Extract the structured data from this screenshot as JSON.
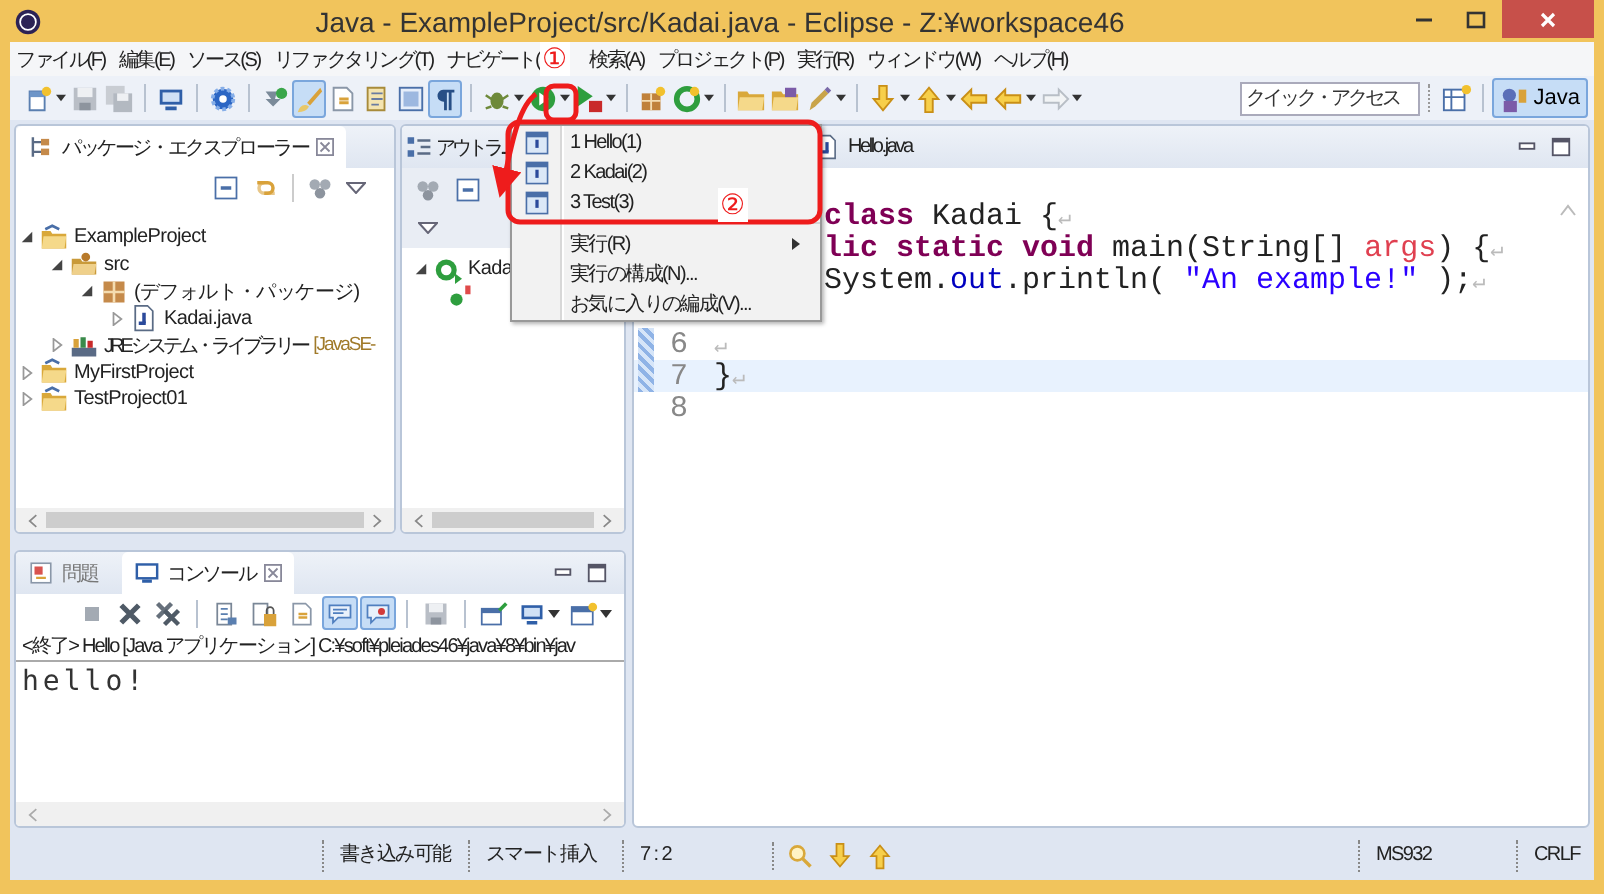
{
  "window": {
    "title": "Java - ExampleProject/src/Kadai.java - Eclipse - Z:¥workspace46"
  },
  "menu_bar": [
    "ファイル(F)",
    "編集(E)",
    "ソース(S)",
    "リファクタリング(T)",
    "ナビゲート(",
    "検索(A)",
    "プロジェクト(P)",
    "実行(R)",
    "ウィンドウ(W)",
    "ヘルプ(H)"
  ],
  "toolbar": [
    {
      "kind": "newdoc",
      "pressed": false,
      "dropdown": true
    },
    {
      "kind": "save",
      "pressed": false,
      "dropdown": false
    },
    {
      "kind": "saveall",
      "pressed": false,
      "dropdown": false
    },
    {
      "kind": "separator"
    },
    {
      "kind": "monitor",
      "pressed": false,
      "dropdown": false
    },
    {
      "kind": "separator"
    },
    {
      "kind": "gear",
      "pressed": false,
      "dropdown": false
    },
    {
      "kind": "separator"
    },
    {
      "kind": "pin",
      "pressed": false,
      "dropdown": false
    },
    {
      "kind": "brush",
      "pressed": true,
      "dropdown": false
    },
    {
      "kind": "docarrow",
      "pressed": false,
      "dropdown": false
    },
    {
      "kind": "docedit",
      "pressed": false,
      "dropdown": false
    },
    {
      "kind": "window",
      "pressed": false,
      "dropdown": false
    },
    {
      "kind": "pilcrow",
      "pressed": true,
      "dropdown": false
    },
    {
      "kind": "separator"
    },
    {
      "kind": "debug",
      "pressed": false,
      "dropdown": true
    },
    {
      "kind": "run",
      "pressed": false,
      "dropdown": true
    },
    {
      "kind": "runext",
      "pressed": false,
      "dropdown": true
    },
    {
      "kind": "separator"
    },
    {
      "kind": "classnew",
      "pressed": false,
      "dropdown": false
    },
    {
      "kind": "gcircle",
      "pressed": false,
      "dropdown": true
    },
    {
      "kind": "separator"
    },
    {
      "kind": "folder",
      "pressed": false,
      "dropdown": false
    },
    {
      "kind": "folderpkg",
      "pressed": false,
      "dropdown": false
    },
    {
      "kind": "marker",
      "pressed": false,
      "dropdown": true
    },
    {
      "kind": "separator"
    },
    {
      "kind": "down",
      "pressed": false,
      "dropdown": true
    },
    {
      "kind": "up",
      "pressed": false,
      "dropdown": true
    },
    {
      "kind": "back",
      "pressed": false,
      "dropdown": false
    },
    {
      "kind": "left",
      "pressed": false,
      "dropdown": true
    },
    {
      "kind": "right",
      "pressed": false,
      "dropdown": true
    }
  ],
  "quick_access": {
    "placeholder": "クイック・アクセス"
  },
  "perspectives": [
    {
      "label": "Java",
      "selected": true
    }
  ],
  "package_explorer": {
    "title": "パッケージ・エクスプローラー",
    "tree": [
      {
        "label": "ExampleProject",
        "kind": "project",
        "expanded": true,
        "children": [
          {
            "label": "src",
            "kind": "srcfolder",
            "expanded": true,
            "children": [
              {
                "label": "(デフォルト・パッケージ)",
                "kind": "package",
                "expanded": true,
                "children": [
                  {
                    "label": "Kadai.java",
                    "kind": "javafile",
                    "expanded": false
                  }
                ]
              }
            ]
          },
          {
            "label": "JRE システム・ライブラリー",
            "decoration": "[JavaSE-",
            "kind": "library",
            "expanded": false
          }
        ]
      },
      {
        "label": "MyFirstProject",
        "kind": "project",
        "expanded": false
      },
      {
        "label": "TestProject01",
        "kind": "project",
        "expanded": false
      }
    ]
  },
  "outline": {
    "title": "アウトラ...",
    "tree": [
      {
        "label": "Kada",
        "kind": "classnode",
        "expanded": true,
        "children": [
          {
            "kind": "method"
          }
        ]
      }
    ]
  },
  "run_menu": {
    "items": [
      {
        "kind": "launch",
        "label": "1 Hello(1)"
      },
      {
        "kind": "launch",
        "label": "2 Kadai(2)"
      },
      {
        "kind": "launch",
        "label": "3 Test(3)"
      },
      {
        "kind": "separator"
      },
      {
        "kind": "submenu",
        "label": "実行(R)"
      },
      {
        "kind": "command",
        "label": "実行の構成(N)..."
      },
      {
        "kind": "command",
        "label": "お気に入りの編成(V)..."
      }
    ]
  },
  "annotations": [
    {
      "kind": "step",
      "label": "①"
    },
    {
      "kind": "step",
      "label": "②"
    }
  ],
  "editor": {
    "tabs": [
      {
        "label": "Hello.java",
        "selected": false
      }
    ],
    "lines": [
      {
        "kind": "covered"
      },
      {
        "kind": "partial",
        "tokens": [
          {
            "t": "class",
            "kind": "keyword"
          },
          {
            "t": " Kadai {",
            "kind": "plain"
          },
          {
            "t": "↵",
            "kind": "mark"
          }
        ]
      },
      {
        "kind": "partial",
        "tokens": [
          {
            "t": "lic static void",
            "kind": "keyword"
          },
          {
            "t": " main(String[] ",
            "kind": "plain"
          },
          {
            "t": "args",
            "kind": "param"
          },
          {
            "t": ") {",
            "kind": "plain"
          },
          {
            "t": "↵",
            "kind": "mark"
          }
        ]
      },
      {
        "kind": "partial",
        "tokens": [
          {
            "t": "System.",
            "kind": "plain"
          },
          {
            "t": "out",
            "kind": "field"
          },
          {
            "t": ".println( ",
            "kind": "plain"
          },
          {
            "t": "\"An example!\"",
            "kind": "string"
          },
          {
            "t": " );",
            "kind": "plain"
          },
          {
            "t": "↵",
            "kind": "mark"
          }
        ]
      },
      {
        "kind": "covered"
      },
      {
        "kind": "code",
        "number": "6",
        "current": false,
        "tokens": [
          {
            "t": "↵",
            "kind": "mark"
          }
        ]
      },
      {
        "kind": "code",
        "number": "7",
        "current": true,
        "tokens": [
          {
            "t": "}",
            "kind": "plain"
          },
          {
            "t": "↵",
            "kind": "mark"
          }
        ]
      },
      {
        "kind": "code",
        "number": "8",
        "current": false
      }
    ]
  },
  "console": {
    "tabs": [
      {
        "label": "問題",
        "selected": false
      },
      {
        "label": "コンソール",
        "selected": true
      }
    ],
    "toolbar": [
      {
        "kind": "stop",
        "pressed": false,
        "dropdown": false
      },
      {
        "kind": "remove",
        "pressed": false,
        "dropdown": false
      },
      {
        "kind": "removeall",
        "pressed": false,
        "dropdown": false
      },
      {
        "kind": "separator"
      },
      {
        "kind": "sheet",
        "pressed": false,
        "dropdown": false
      },
      {
        "kind": "lockdoc",
        "pressed": false,
        "dropdown": false
      },
      {
        "kind": "docarrow",
        "pressed": false,
        "dropdown": false
      },
      {
        "kind": "chat",
        "pressed": true,
        "dropdown": false
      },
      {
        "kind": "chatred",
        "pressed": true,
        "dropdown": false
      },
      {
        "kind": "separator"
      },
      {
        "kind": "save",
        "pressed": false,
        "dropdown": false
      },
      {
        "kind": "separator"
      },
      {
        "kind": "pinwin",
        "pressed": false,
        "dropdown": false
      },
      {
        "kind": "monitor",
        "pressed": false,
        "dropdown": true
      },
      {
        "kind": "newwin",
        "pressed": false,
        "dropdown": true
      }
    ],
    "header": "<終了> Hello [Java アプリケーション] C:¥soft¥pleiades46¥java¥8¥bin¥jav",
    "output": "hello!"
  },
  "status_bar": {
    "fields": [
      "書き込み可能",
      "スマート挿入",
      "7 : 2",
      "MS932",
      "CRLF"
    ]
  }
}
